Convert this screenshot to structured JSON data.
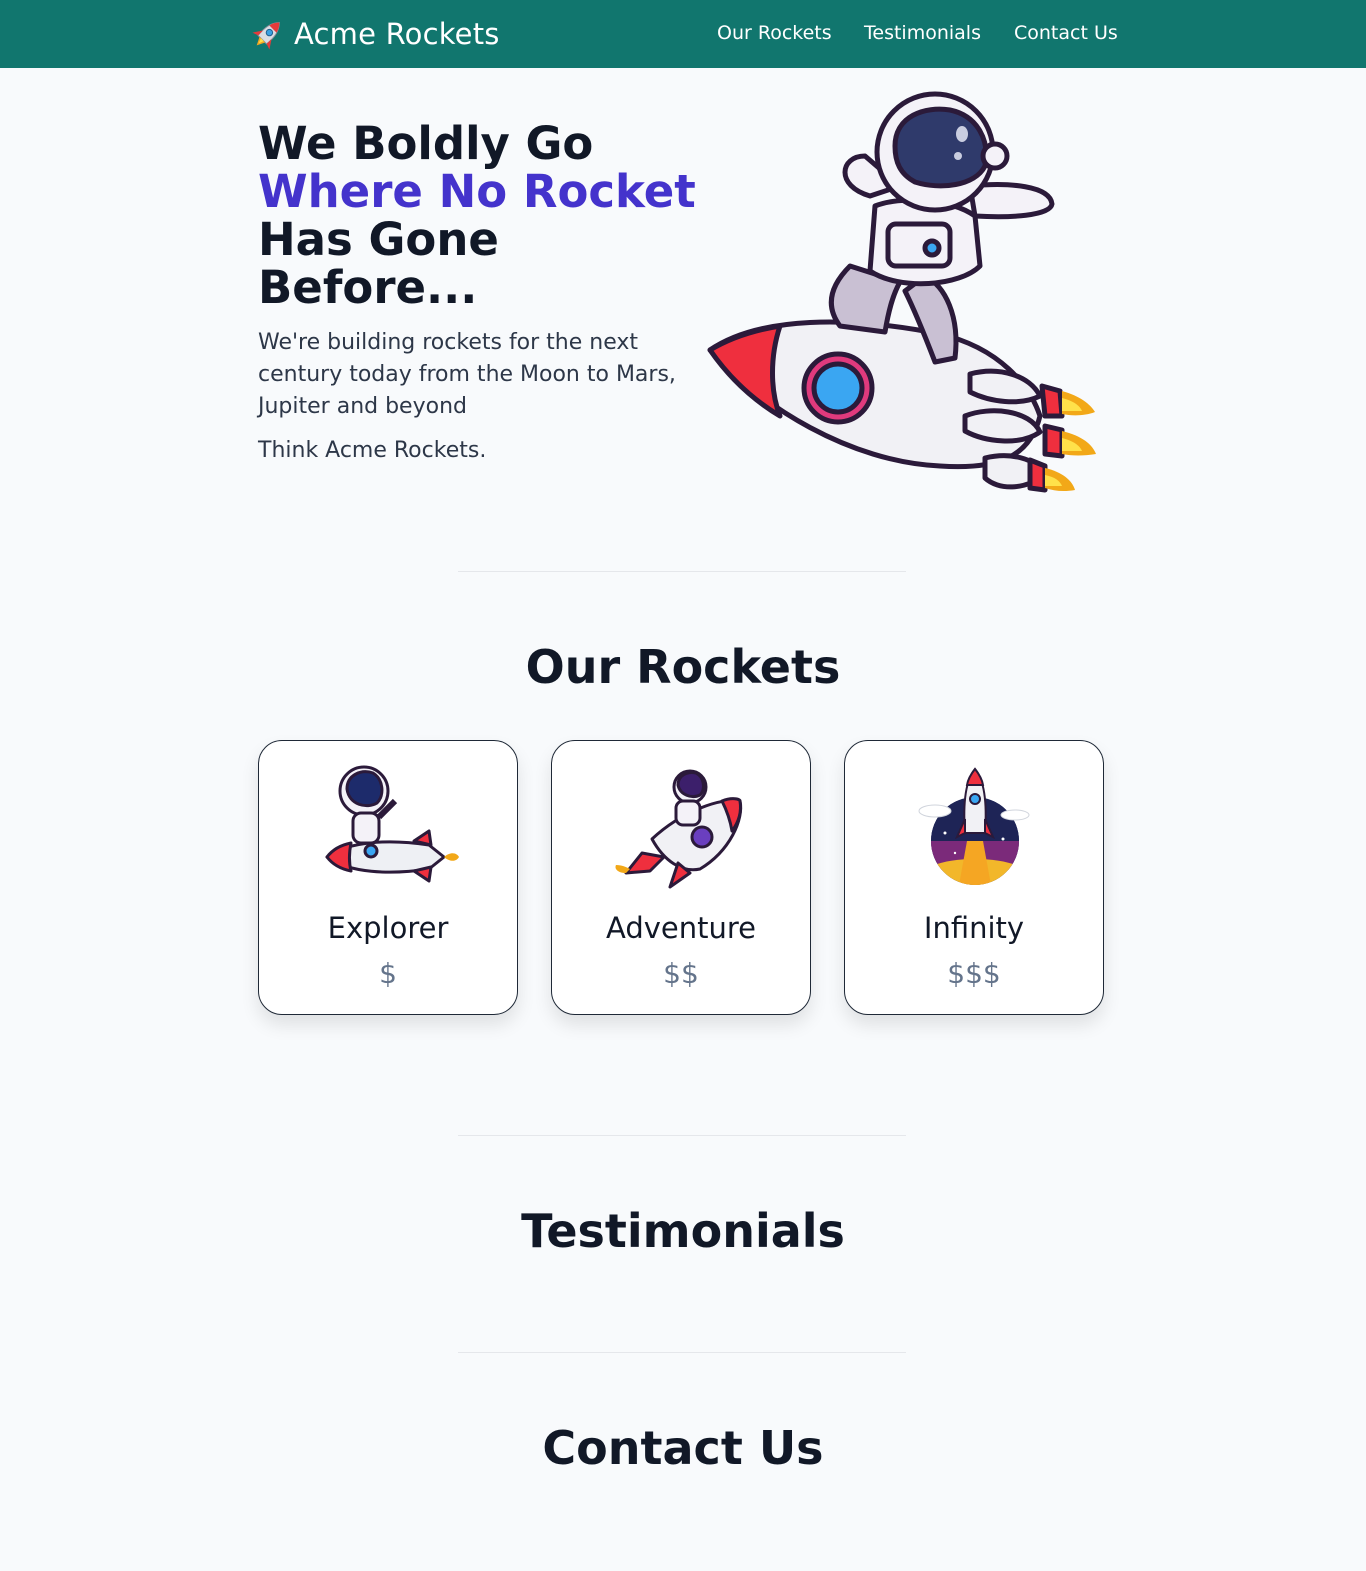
{
  "header": {
    "brand_name": "Acme Rockets",
    "brand_icon": "rocket-icon",
    "nav": [
      {
        "label": "Our Rockets"
      },
      {
        "label": "Testimonials"
      },
      {
        "label": "Contact Us"
      }
    ],
    "bg_color": "#11766e"
  },
  "hero": {
    "title_line1": "We Boldly Go",
    "title_accent": "Where No Rocket",
    "title_line3": "Has Gone",
    "title_line4": "Before...",
    "subtitle": "We're building rockets for the next century today from the Moon to Mars, Jupiter and beyond",
    "tagline": "Think Acme Rockets.",
    "accent_color": "#4433cc",
    "image": "astronaut-riding-rocket-illustration"
  },
  "rockets": {
    "title": "Our Rockets",
    "cards": [
      {
        "name": "Explorer",
        "price": "$",
        "image": "astronaut-on-rocket-illustration"
      },
      {
        "name": "Adventure",
        "price": "$$",
        "image": "astronaut-flying-rocket-illustration"
      },
      {
        "name": "Infinity",
        "price": "$$$",
        "image": "rocket-launch-badge-illustration"
      }
    ]
  },
  "testimonials": {
    "title": "Testimonials"
  },
  "contact": {
    "title": "Contact Us"
  }
}
